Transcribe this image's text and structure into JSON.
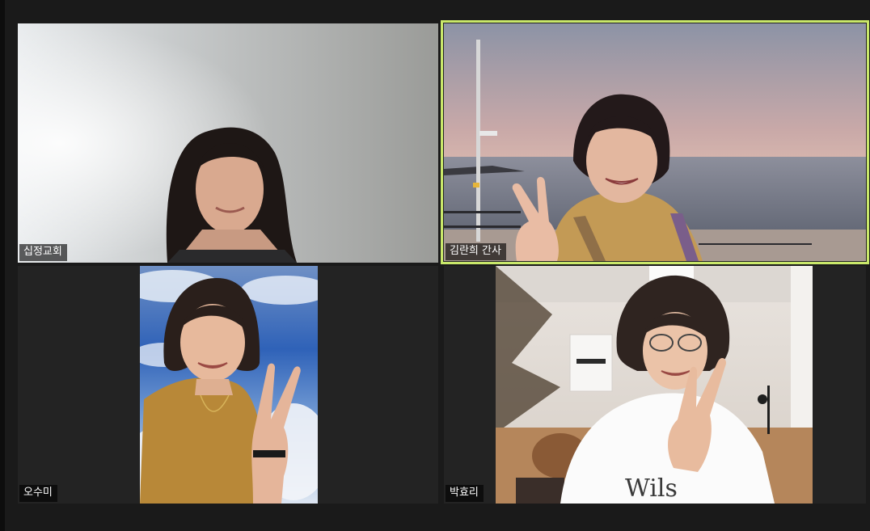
{
  "meeting": {
    "view": "gallery",
    "active_speaker_color": "#c9e86a"
  },
  "participants": [
    {
      "name": "십정교회"
    },
    {
      "name": "김란희 간사",
      "active_speaker": true
    },
    {
      "name": "오수미"
    },
    {
      "name": "박효리"
    }
  ]
}
